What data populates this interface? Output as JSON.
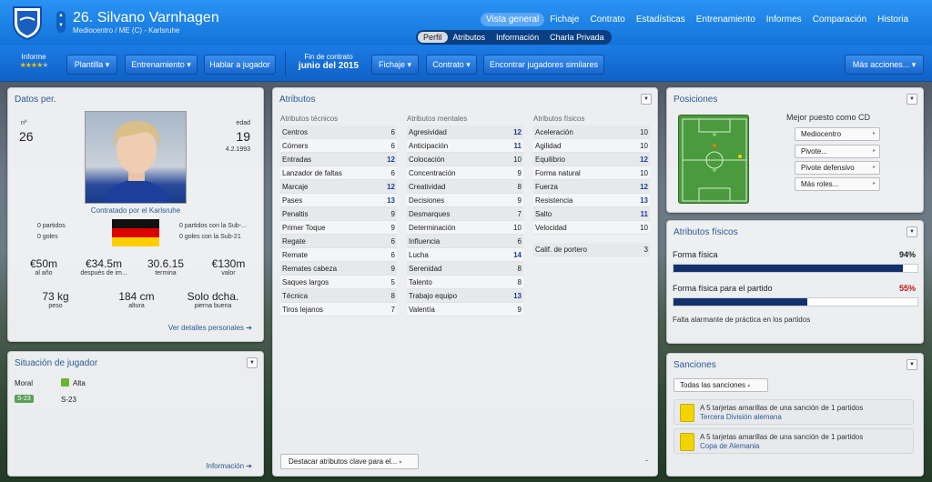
{
  "header": {
    "player_title": "26. Silvano Varnhagen",
    "subtitle": "Mediocentro / ME (C) - Karlsruhe",
    "nav": [
      "Vista general",
      "Fichaje",
      "Contrato",
      "Estadísticas",
      "Entrenamiento",
      "Informes",
      "Comparación",
      "Historia"
    ],
    "subnav": [
      "Perfil",
      "Atributos",
      "Información",
      "Charla Privada"
    ]
  },
  "toolbar": {
    "informe_label": "Informe",
    "rating_stars": 3.5,
    "plantilla": "Plantilla",
    "entrenamiento": "Entrenamiento",
    "hablar": "Hablar a jugador",
    "contract_label": "Fin de contrato",
    "contract_date": "junio del 2015",
    "fichaje": "Fichaje",
    "contrato": "Contrato",
    "similares": "Encontrar jugadores similares",
    "mas": "Más acciones..."
  },
  "datos": {
    "title": "Datos per.",
    "num_label": "nº",
    "num": "26",
    "age_label": "edad",
    "age": "19",
    "dob": "4.2.1993",
    "signed": "Contratado por el Karlsruhe",
    "partidos": "0 partidos",
    "goles": "0 goles",
    "sub_partidos": "0 partidos con la Sub-...",
    "sub_goles": "0 goles con la Sub-21",
    "wage": "€50m",
    "wage_l": "al año",
    "m2": "€34.5m",
    "m2_l": "después de im...",
    "expires": "30.6.15",
    "expires_l": "termina",
    "value": "€130m",
    "value_l": "valor",
    "weight": "73 kg",
    "weight_l": "peso",
    "height": "184 cm",
    "height_l": "altura",
    "foot": "Solo dcha.",
    "foot_l": "pierna buena",
    "link": "Ver detalles personales"
  },
  "situacion": {
    "title": "Situación de jugador",
    "moral_l": "Moral",
    "moral_v": "Alta",
    "badge": "S-23",
    "badge_v": "S-23",
    "link": "Información"
  },
  "atributos": {
    "title": "Atributos",
    "tec_h": "Atributos técnicos",
    "men_h": "Atributos mentales",
    "fis_h": "Atributos físicos",
    "tecnicos": [
      {
        "n": "Centros",
        "v": "6"
      },
      {
        "n": "Córners",
        "v": "6"
      },
      {
        "n": "Entradas",
        "v": "12"
      },
      {
        "n": "Lanzador de faltas",
        "v": "6"
      },
      {
        "n": "Marcaje",
        "v": "12"
      },
      {
        "n": "Pases",
        "v": "13"
      },
      {
        "n": "Penaltis",
        "v": "9"
      },
      {
        "n": "Primer Toque",
        "v": "9"
      },
      {
        "n": "Regate",
        "v": "6"
      },
      {
        "n": "Remate",
        "v": "6"
      },
      {
        "n": "Remates cabeza",
        "v": "9"
      },
      {
        "n": "Saques largos",
        "v": "5"
      },
      {
        "n": "Técnica",
        "v": "8"
      },
      {
        "n": "Tiros lejanos",
        "v": "7"
      }
    ],
    "mentales": [
      {
        "n": "Agresividad",
        "v": "12"
      },
      {
        "n": "Anticipación",
        "v": "11"
      },
      {
        "n": "Colocación",
        "v": "10"
      },
      {
        "n": "Concentración",
        "v": "9"
      },
      {
        "n": "Creatividad",
        "v": "8"
      },
      {
        "n": "Decisiones",
        "v": "9"
      },
      {
        "n": "Desmarques",
        "v": "7"
      },
      {
        "n": "Determinación",
        "v": "10"
      },
      {
        "n": "Influencia",
        "v": "6"
      },
      {
        "n": "Lucha",
        "v": "14"
      },
      {
        "n": "Serenidad",
        "v": "8"
      },
      {
        "n": "Talento",
        "v": "8"
      },
      {
        "n": "Trabajo equipo",
        "v": "13"
      },
      {
        "n": "Valentía",
        "v": "9"
      }
    ],
    "fisicos": [
      {
        "n": "Aceleración",
        "v": "10"
      },
      {
        "n": "Agilidad",
        "v": "10"
      },
      {
        "n": "Equilibrio",
        "v": "12"
      },
      {
        "n": "Forma natural",
        "v": "10"
      },
      {
        "n": "Fuerza",
        "v": "12"
      },
      {
        "n": "Resistencia",
        "v": "13"
      },
      {
        "n": "Salto",
        "v": "11"
      },
      {
        "n": "Velocidad",
        "v": "10"
      }
    ],
    "portero": {
      "n": "Calif. de portero",
      "v": "3"
    },
    "highlight": "Destacar atributos clave para el..."
  },
  "posiciones": {
    "title": "Posiciones",
    "best_label": "Mejor puesto como CD",
    "roles": [
      "Mediocentro",
      "Pivote...",
      "Pivote defensivo",
      "Más roles..."
    ]
  },
  "fisicos": {
    "title": "Atributos físicos",
    "forma_l": "Forma física",
    "forma_v": "94%",
    "forma_pct": 94,
    "partido_l": "Forma física para el partido",
    "partido_v": "55%",
    "partido_pct": 55,
    "note": "Falta alarmante de práctica en los partidos"
  },
  "sanciones": {
    "title": "Sanciones",
    "filter": "Todas las sanciones",
    "items": [
      {
        "t": "A 5 tarjetas amarillas de una sanción de 1 partidos",
        "c": "Tercera División alemana"
      },
      {
        "t": "A 5 tarjetas amarillas de una sanción de 1 partidos",
        "c": "Copa de Alemania"
      }
    ]
  },
  "colors": {
    "accent": "#1273d9",
    "title": "#2b5b98",
    "bar": "#12316c",
    "warn": "#c0171b"
  }
}
